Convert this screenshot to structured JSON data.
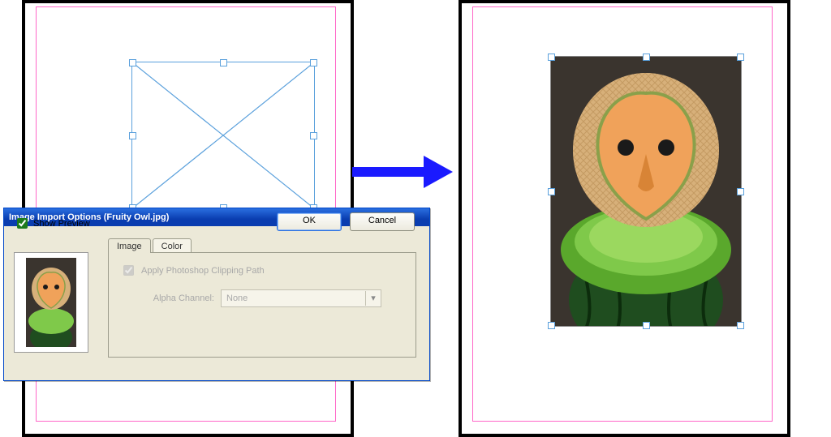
{
  "dialog": {
    "title": "Image Import Options (Fruity Owl.jpg)",
    "show_preview_label": "Show Preview",
    "show_preview_checked": true,
    "tabs": {
      "image": "Image",
      "color": "Color"
    },
    "apply_clipping_label": "Apply Photoshop Clipping Path",
    "apply_clipping_checked": true,
    "alpha_label": "Alpha Channel:",
    "alpha_value": "None",
    "ok": "OK",
    "cancel": "Cancel"
  }
}
